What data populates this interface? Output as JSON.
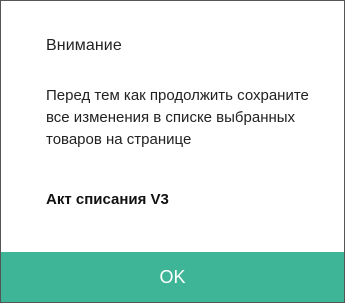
{
  "dialog": {
    "title": "Внимание",
    "message": "Перед тем как продолжить сохраните все изменения в списке выбранных товаров на странице",
    "document_name": "Акт списания V3",
    "ok_label": "OK"
  },
  "colors": {
    "button_bg": "#3db596",
    "button_text": "#ffffff",
    "text": "#222222",
    "border": "#555555"
  }
}
